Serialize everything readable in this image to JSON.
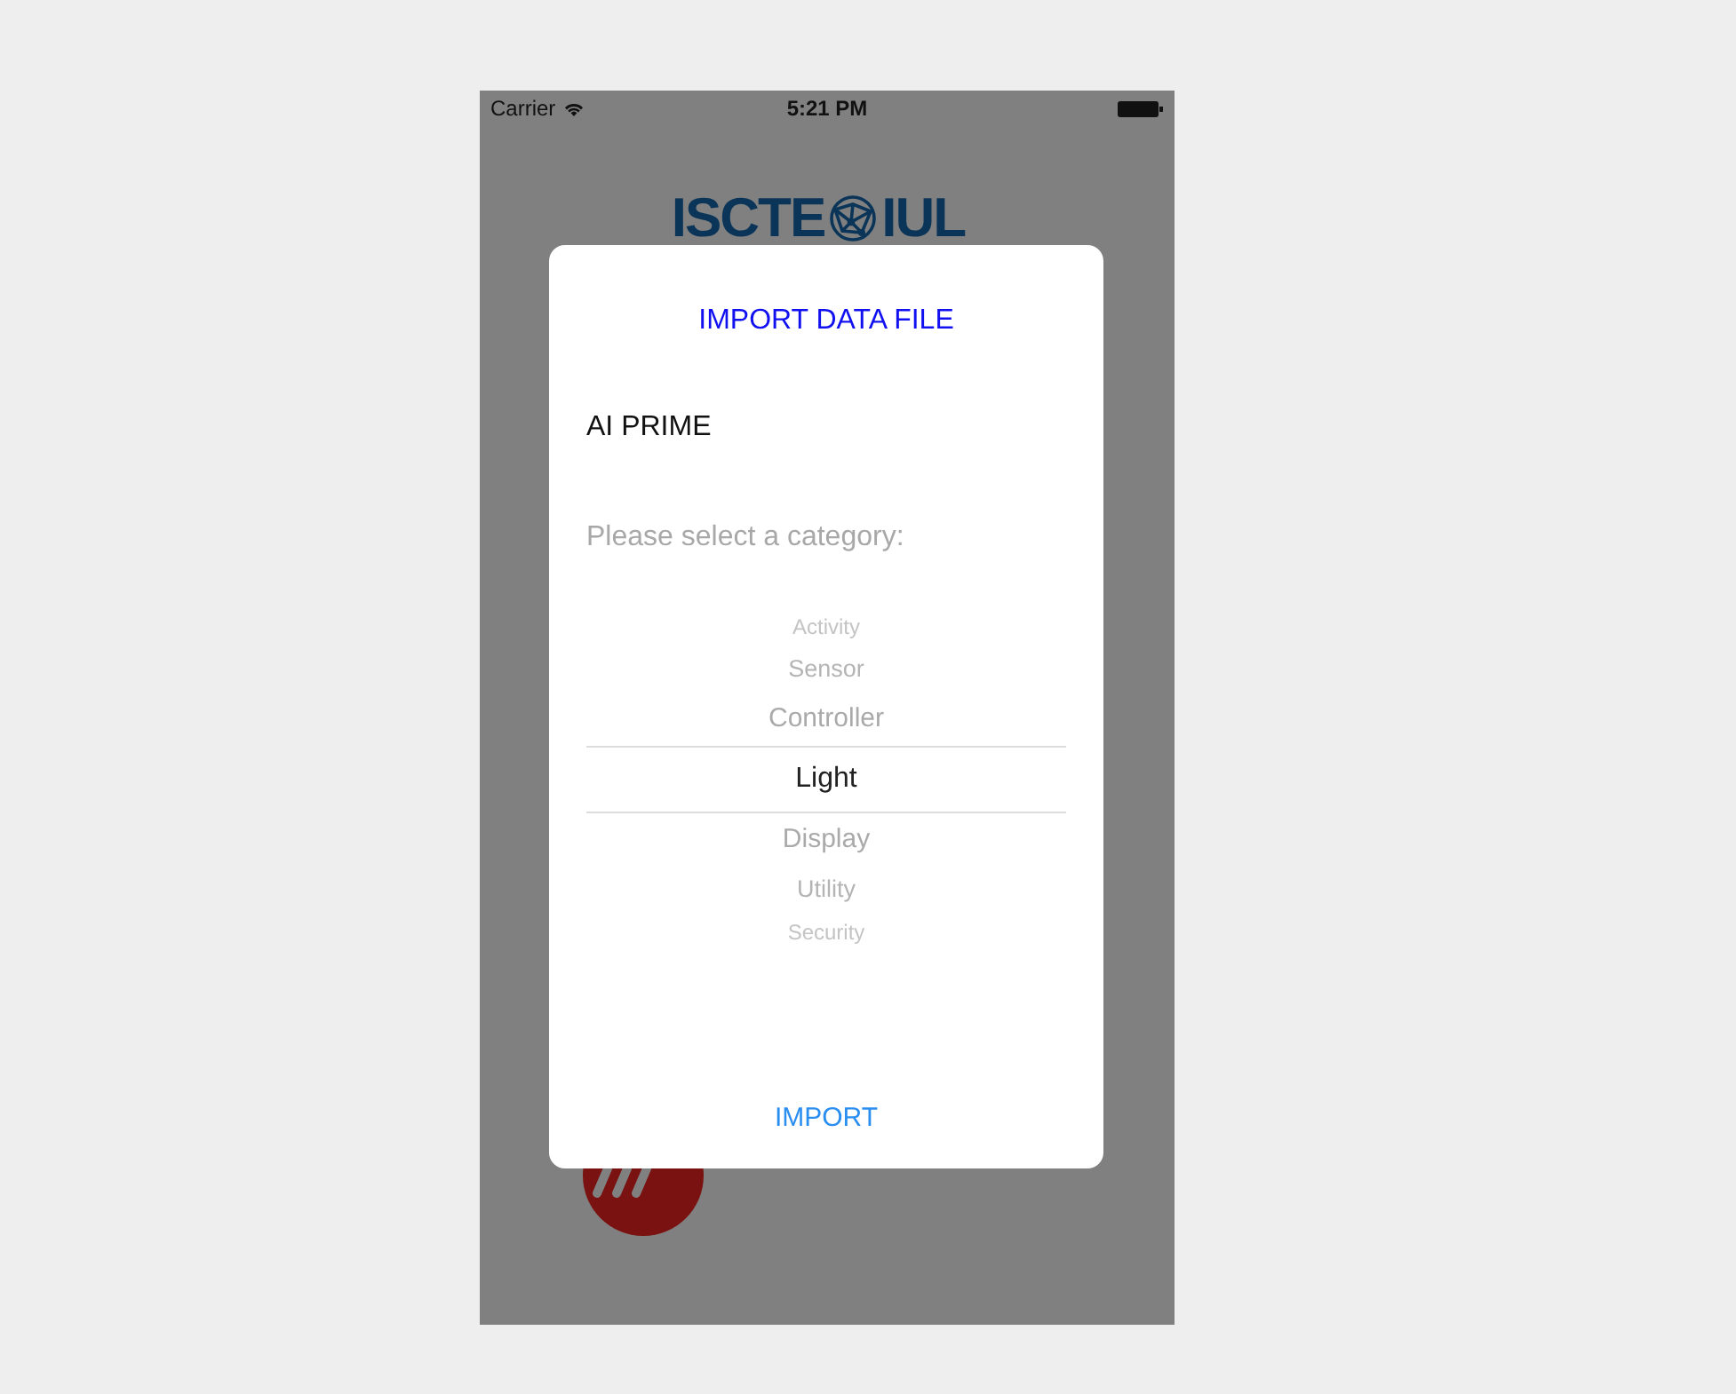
{
  "status_bar": {
    "carrier": "Carrier",
    "time": "5:21 PM"
  },
  "header_logo": {
    "left": "ISCTE",
    "right": "IUL"
  },
  "dialog": {
    "title": "IMPORT DATA FILE",
    "file_name": "AI PRIME",
    "prompt": "Please select a category:",
    "picker": [
      {
        "label": "Activity",
        "selected": false
      },
      {
        "label": "Sensor",
        "selected": false
      },
      {
        "label": "Controller",
        "selected": false
      },
      {
        "label": "Light",
        "selected": true
      },
      {
        "label": "Display",
        "selected": false
      },
      {
        "label": "Utility",
        "selected": false
      },
      {
        "label": "Security",
        "selected": false
      }
    ],
    "button": "IMPORT"
  }
}
